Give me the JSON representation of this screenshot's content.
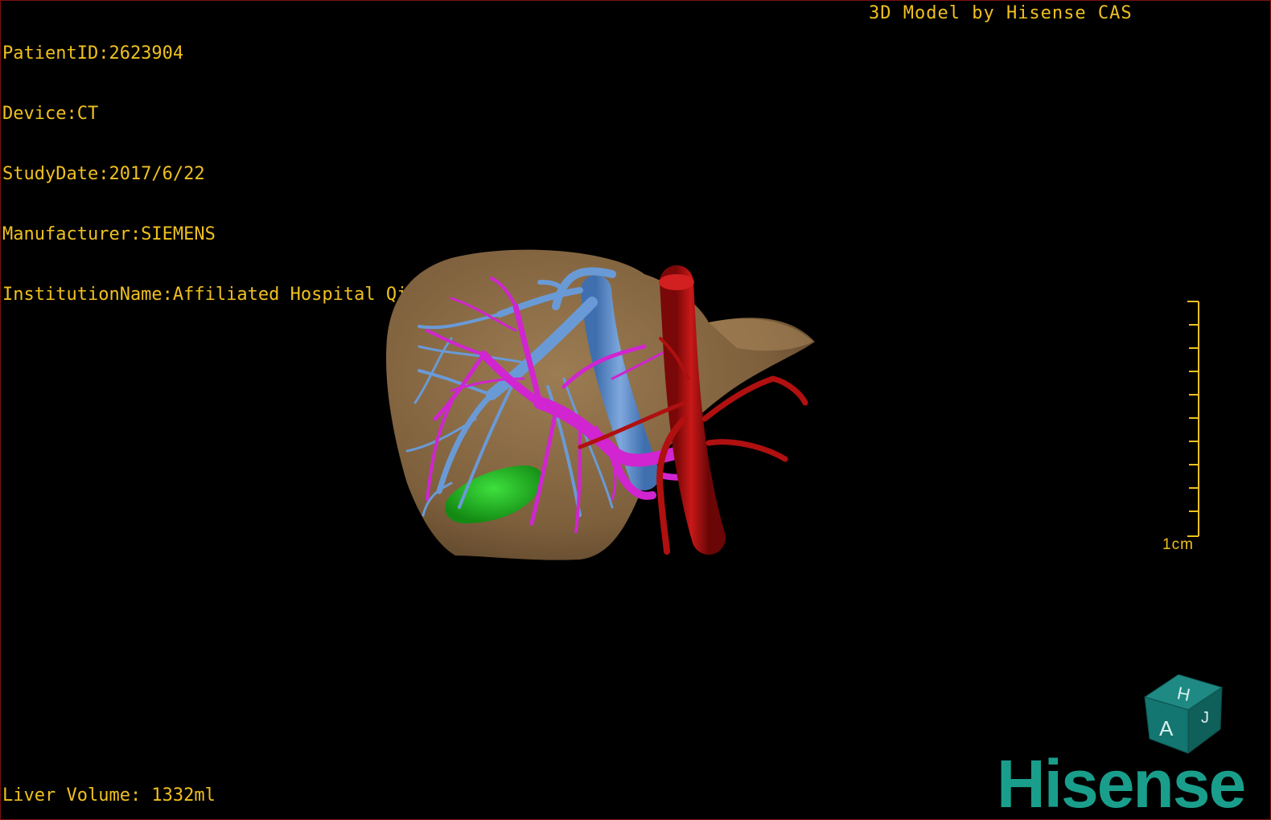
{
  "header": {
    "patient_id": "PatientID:2623904",
    "device": "Device:CT",
    "study_date": "StudyDate:2017/6/22",
    "manufacturer": "Manufacturer:SIEMENS",
    "institution": "InstitutionName:Affiliated Hospital Qingdao University-C"
  },
  "title": "3D Model by Hisense CAS",
  "footer": {
    "liver_volume": "Liver Volume: 1332ml"
  },
  "scale": {
    "label": "1cm"
  },
  "orientation_cube": {
    "face_top": "H",
    "face_front": "A",
    "face_side": "J"
  },
  "brand": {
    "logo_text": "Hisense"
  },
  "colors": {
    "overlay_text": "#f0c020",
    "liver": "#8a6a44",
    "portal_vein": "#cc22cc",
    "hepatic_vein": "#5b8fd0",
    "artery": "#b01010",
    "gallbladder": "#1fb31f",
    "brand": "#1a9e8c",
    "border": "#7a1010"
  }
}
